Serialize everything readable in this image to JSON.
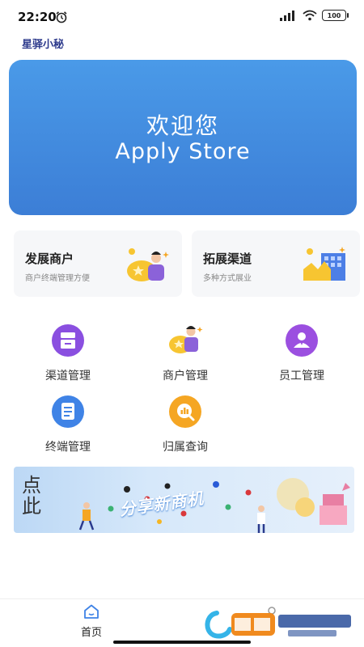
{
  "status_bar": {
    "time": "22:20",
    "battery": "100"
  },
  "app": {
    "title": "星驿小秘"
  },
  "hero": {
    "line1": "欢迎您",
    "line2": "Apply Store"
  },
  "cards": [
    {
      "title": "发展商户",
      "subtitle": "商户终端管理方便",
      "icon": "merchant-coin-illustration"
    },
    {
      "title": "拓展渠道",
      "subtitle": "多种方式展业",
      "icon": "channel-building-illustration"
    }
  ],
  "menu": [
    {
      "label": "渠道管理",
      "icon": "channel-box-icon",
      "color": "#8a4fe0"
    },
    {
      "label": "商户管理",
      "icon": "merchant-person-icon",
      "color": "#f5b623"
    },
    {
      "label": "员工管理",
      "icon": "staff-person-icon",
      "color": "#9b4fe0"
    },
    {
      "label": "终端管理",
      "icon": "terminal-document-icon",
      "color": "#3f83e6"
    },
    {
      "label": "归属查询",
      "icon": "query-chart-icon",
      "color": "#f5a623"
    }
  ],
  "banner": {
    "calligraphy": "点此",
    "text": "分享新商机"
  },
  "tabbar": {
    "home_label": "首页"
  },
  "colors": {
    "hero_top": "#4a9ae8",
    "hero_bottom": "#3c7ed6",
    "title": "#2d3a8c"
  }
}
